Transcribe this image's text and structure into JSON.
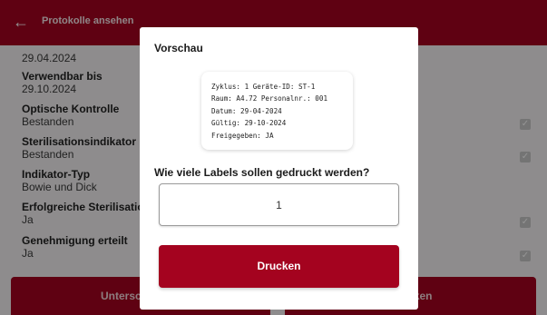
{
  "app_bar": {
    "title": "Protokolle ansehen",
    "back_icon": "arrow-left-icon",
    "color": "#a4031f"
  },
  "fields": [
    {
      "label": "",
      "value": "29.04.2024"
    },
    {
      "label": "Verwendbar bis",
      "value": "29.10.2024"
    },
    {
      "label": "Optische Kontrolle",
      "value": "Bestanden"
    },
    {
      "label": "Sterilisationsindikator",
      "value": "Bestanden"
    },
    {
      "label": "Indikator-Typ",
      "value": "Bowie und Dick"
    },
    {
      "label": "Erfolgreiche Sterilisation",
      "value": "Ja"
    },
    {
      "label": "Genehmigung erteilt",
      "value": "Ja"
    }
  ],
  "checkboxes": {
    "icon": "check-icon",
    "checked": true
  },
  "bottom_buttons": {
    "left_label": "Unterschreiben",
    "right_label": "Drucken"
  },
  "dialog": {
    "title": "Vorschau",
    "preview_lines": [
      "Zyklus: 1 Geräte-ID: ST-1",
      "Raum: A4.72 Personalnr.: 001",
      "Datum: 29-04-2024",
      "Gültig: 29-10-2024",
      "Freigegeben: JA"
    ],
    "question": "Wie viele Labels sollen gedruckt werden?",
    "quantity_value": "1",
    "print_button": "Drucken"
  }
}
